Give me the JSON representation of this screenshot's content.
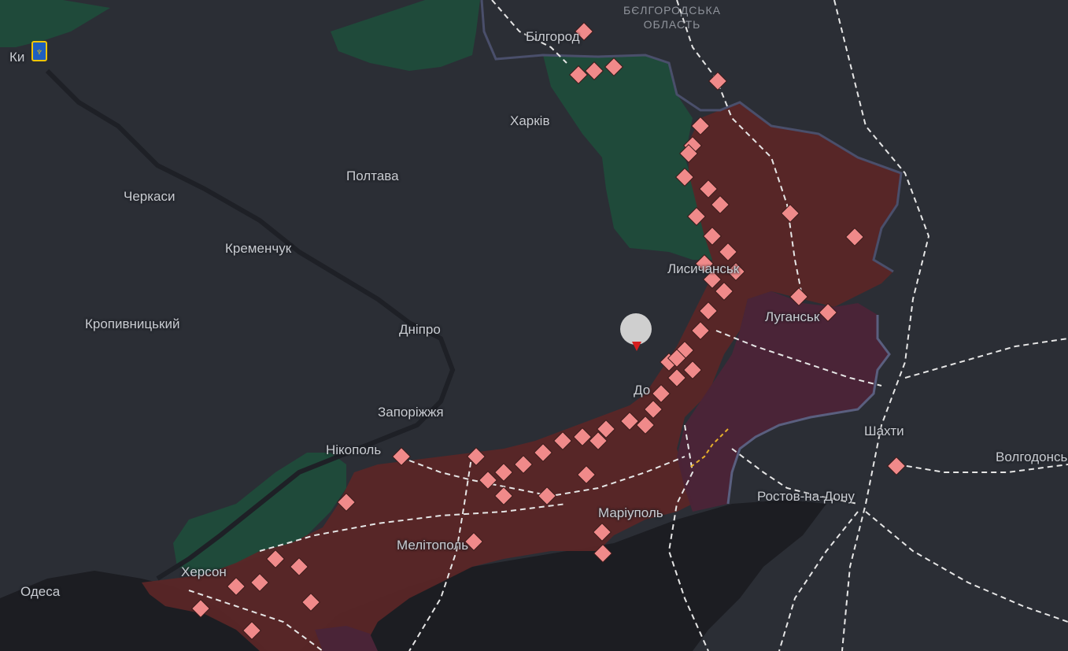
{
  "map": {
    "colors": {
      "background": "#2b2e35",
      "sea": "#1c1d22",
      "occupied": "#5a2627",
      "occupied_before_2022": "#4a2437",
      "liberated": "#1f4a3a",
      "border": "#4a4f6b",
      "rail": "#e6e6e6",
      "marker": "#f08a8a"
    },
    "cities": [
      {
        "id": "kyiv",
        "label": "Ки"
      },
      {
        "id": "bilhorod",
        "label": "Білгород"
      },
      {
        "id": "kharkiv",
        "label": "Харків"
      },
      {
        "id": "poltava",
        "label": "Полтава"
      },
      {
        "id": "cherkasy",
        "label": "Черкаси"
      },
      {
        "id": "kremenchuk",
        "label": "Кременчук"
      },
      {
        "id": "kropyvnytskyi",
        "label": "Кропивницький"
      },
      {
        "id": "dnipro",
        "label": "Дніпро"
      },
      {
        "id": "lysychansk",
        "label": "Лисичанськ"
      },
      {
        "id": "luhansk",
        "label": "Луганськ"
      },
      {
        "id": "donetsk",
        "label": "До"
      },
      {
        "id": "zaporizhzhia",
        "label": "Запоріжжя"
      },
      {
        "id": "nikopol",
        "label": "Нікополь"
      },
      {
        "id": "mariupol",
        "label": "Маріуполь"
      },
      {
        "id": "melitopol",
        "label": "Мелітополь"
      },
      {
        "id": "kherson",
        "label": "Херсон"
      },
      {
        "id": "odesa",
        "label": "Одеса"
      },
      {
        "id": "shakhty",
        "label": "Шахти"
      },
      {
        "id": "volgodonsk",
        "label": "Волгодонськ"
      },
      {
        "id": "rostov",
        "label": "Ростов-на-Дону"
      }
    ],
    "region_label": [
      "БЄЛГОРОДСЬКА",
      "ОБЛАСТЬ"
    ]
  }
}
